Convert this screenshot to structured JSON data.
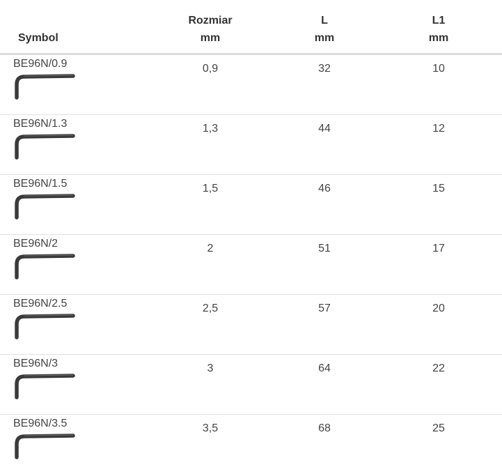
{
  "header": {
    "symbol": "Symbol",
    "rozmiar": [
      "Rozmiar",
      "mm"
    ],
    "l": [
      "L",
      "mm"
    ],
    "l1": [
      "L1",
      "mm"
    ]
  },
  "rows": [
    {
      "symbol": "BE96N/0.9",
      "rozmiar": "0,9",
      "l": "32",
      "l1": "10",
      "icon": "hex-key-icon"
    },
    {
      "symbol": "BE96N/1.3",
      "rozmiar": "1,3",
      "l": "44",
      "l1": "12",
      "icon": "hex-key-icon"
    },
    {
      "symbol": "BE96N/1.5",
      "rozmiar": "1,5",
      "l": "46",
      "l1": "15",
      "icon": "hex-key-icon"
    },
    {
      "symbol": "BE96N/2",
      "rozmiar": "2",
      "l": "51",
      "l1": "17",
      "icon": "hex-key-icon"
    },
    {
      "symbol": "BE96N/2.5",
      "rozmiar": "2,5",
      "l": "57",
      "l1": "20",
      "icon": "hex-key-icon"
    },
    {
      "symbol": "BE96N/3",
      "rozmiar": "3",
      "l": "64",
      "l1": "22",
      "icon": "hex-key-icon"
    },
    {
      "symbol": "BE96N/3.5",
      "rozmiar": "3,5",
      "l": "68",
      "l1": "25",
      "icon": "hex-key-icon"
    }
  ],
  "colors": {
    "text": "#444444",
    "header_text": "#333333",
    "header_rule": "#dcdcdc",
    "row_rule": "#e2e2e2",
    "key_metal": "#3a3a3a"
  }
}
